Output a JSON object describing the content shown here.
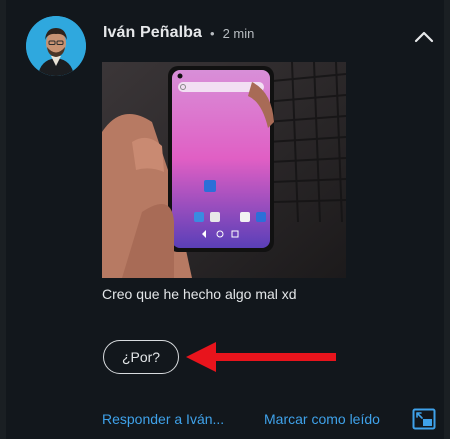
{
  "notification": {
    "sender": "Iván Peñalba",
    "separator": "•",
    "time": "2 min",
    "message": "Creo que he hecho algo mal xd",
    "quick_reply": "¿Por?",
    "actions": {
      "reply": "Responder a Iván...",
      "mark_read": "Marcar como leído"
    }
  },
  "icons": {
    "collapse": "chevron-up-icon",
    "open_window": "picture-in-picture-icon",
    "annotation": "red-arrow-icon"
  },
  "colors": {
    "background": "#12171c",
    "accent": "#3fa2ea",
    "avatar_bg": "#2fa8de",
    "annotation_arrow": "#e8141c"
  }
}
